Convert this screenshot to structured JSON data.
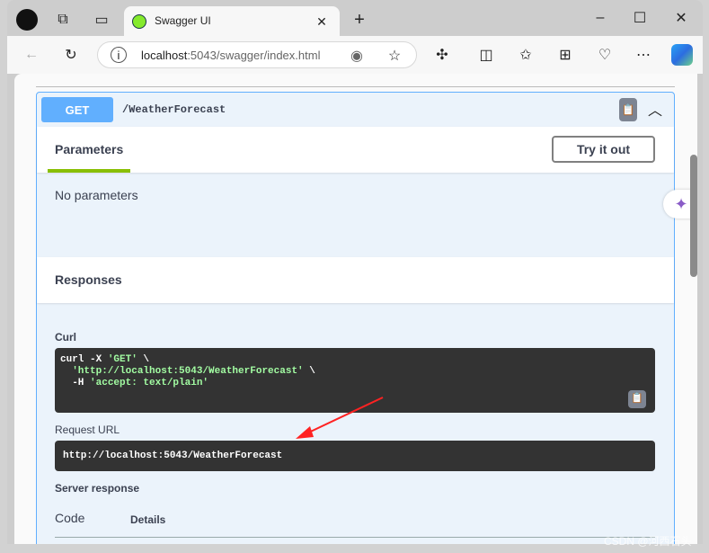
{
  "browser": {
    "tab_title": "Swagger UI",
    "url_host": "localhost",
    "url_rest": ":5043/swagger/index.html"
  },
  "operation": {
    "method": "GET",
    "path": "/WeatherForecast",
    "method_color": "#61affe"
  },
  "parameters": {
    "tab_label": "Parameters",
    "try_button": "Try it out",
    "empty": "No parameters"
  },
  "responses": {
    "title": "Responses",
    "curl_label": "Curl",
    "curl_lines": [
      [
        "curl -X ",
        "'GET'",
        " \\"
      ],
      [
        "  ",
        "'http://localhost:5043/WeatherForecast'",
        " \\"
      ],
      [
        "  -H ",
        "'accept: text/plain'",
        ""
      ]
    ],
    "request_url_label": "Request URL",
    "request_url": "http://localhost:5043/WeatherForecast",
    "server_response_label": "Server response",
    "code_header": "Code",
    "details_header": "Details"
  },
  "watermark": "CSDN @河西石头"
}
